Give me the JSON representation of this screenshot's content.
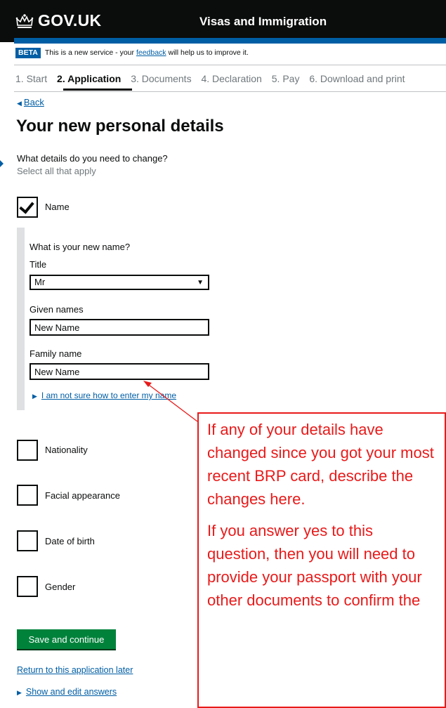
{
  "header": {
    "logo_text": "GOV.UK",
    "service_name": "Visas and Immigration",
    "logo_icon": "crown-icon"
  },
  "beta_banner": {
    "tag": "BETA",
    "text_before": "This is a new service - your ",
    "link": "feedback",
    "text_after": " will help us to improve it."
  },
  "steps": [
    "1. Start",
    "2. Application",
    "3. Documents",
    "4. Declaration",
    "5. Pay",
    "6. Download and print"
  ],
  "current_step": "2. Application",
  "back_link": "Back",
  "page_title": "Your new personal details",
  "question": "What details do you need to change?",
  "hint": "Select all that apply",
  "options": [
    {
      "label": "Name",
      "checked": true
    },
    {
      "label": "Nationality",
      "checked": false
    },
    {
      "label": "Facial appearance",
      "checked": false
    },
    {
      "label": "Date of birth",
      "checked": false
    },
    {
      "label": "Gender",
      "checked": false
    }
  ],
  "name_panel": {
    "question": "What is your new name?",
    "title_label": "Title",
    "title_value": "Mr",
    "given_label": "Given names",
    "given_value": "New Name",
    "family_label": "Family name",
    "family_value": "New Name",
    "help_link": "I am not sure how to enter my name"
  },
  "save_button": "Save and continue",
  "return_link": "Return to this application later",
  "show_answers_link": "Show and edit answers",
  "annotation": {
    "paragraph1": "If any of your details have changed since you got your most recent BRP card, describe the changes here.",
    "paragraph2": "If you answer yes to this question, then you will need to provide your passport with your other documents to confirm the",
    "color": "#e81a1a"
  },
  "colors": {
    "link": "#005ea5",
    "button": "#00823b",
    "header": "#0b0c0c"
  }
}
